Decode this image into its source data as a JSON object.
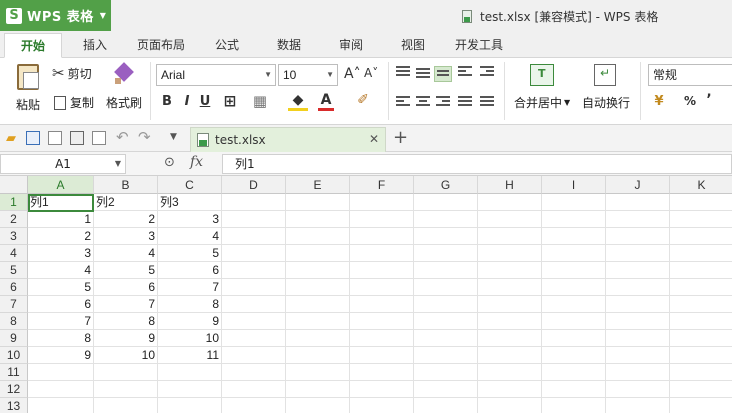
{
  "app": {
    "brand_logo": "S",
    "brand_label": "WPS 表格",
    "window_title": "test.xlsx [兼容模式] - WPS 表格"
  },
  "ribbon_tabs": [
    "开始",
    "插入",
    "页面布局",
    "公式",
    "数据",
    "审阅",
    "视图",
    "开发工具"
  ],
  "active_tab": "开始",
  "ribbon": {
    "paste": "粘贴",
    "cut": "剪切",
    "copy": "复制",
    "format_painter": "格式刷",
    "font_name": "Arial",
    "font_size": "10",
    "bold": "B",
    "italic": "I",
    "underline": "U",
    "merge_center": "合并居中",
    "wrap_text": "自动换行",
    "number_format": "常规",
    "percent": "%",
    "comma": "’"
  },
  "document_tab": {
    "name": "test.xlsx"
  },
  "formula_bar": {
    "cell_ref": "A1",
    "fx": "fx",
    "content": "列1"
  },
  "columns": [
    "A",
    "B",
    "C",
    "D",
    "E",
    "F",
    "G",
    "H",
    "I",
    "J",
    "K"
  ],
  "rows": [
    "1",
    "2",
    "3",
    "4",
    "5",
    "6",
    "7",
    "8",
    "9",
    "10",
    "11",
    "12",
    "13"
  ],
  "cells": [
    [
      "列1",
      "列2",
      "列3"
    ],
    [
      "1",
      "2",
      "3"
    ],
    [
      "2",
      "3",
      "4"
    ],
    [
      "3",
      "4",
      "5"
    ],
    [
      "4",
      "5",
      "6"
    ],
    [
      "5",
      "6",
      "7"
    ],
    [
      "6",
      "7",
      "8"
    ],
    [
      "7",
      "8",
      "9"
    ],
    [
      "8",
      "9",
      "10"
    ],
    [
      "9",
      "10",
      "11"
    ]
  ],
  "colors": {
    "brand_green": "#52a048",
    "selection_green": "#3c8a3c"
  }
}
